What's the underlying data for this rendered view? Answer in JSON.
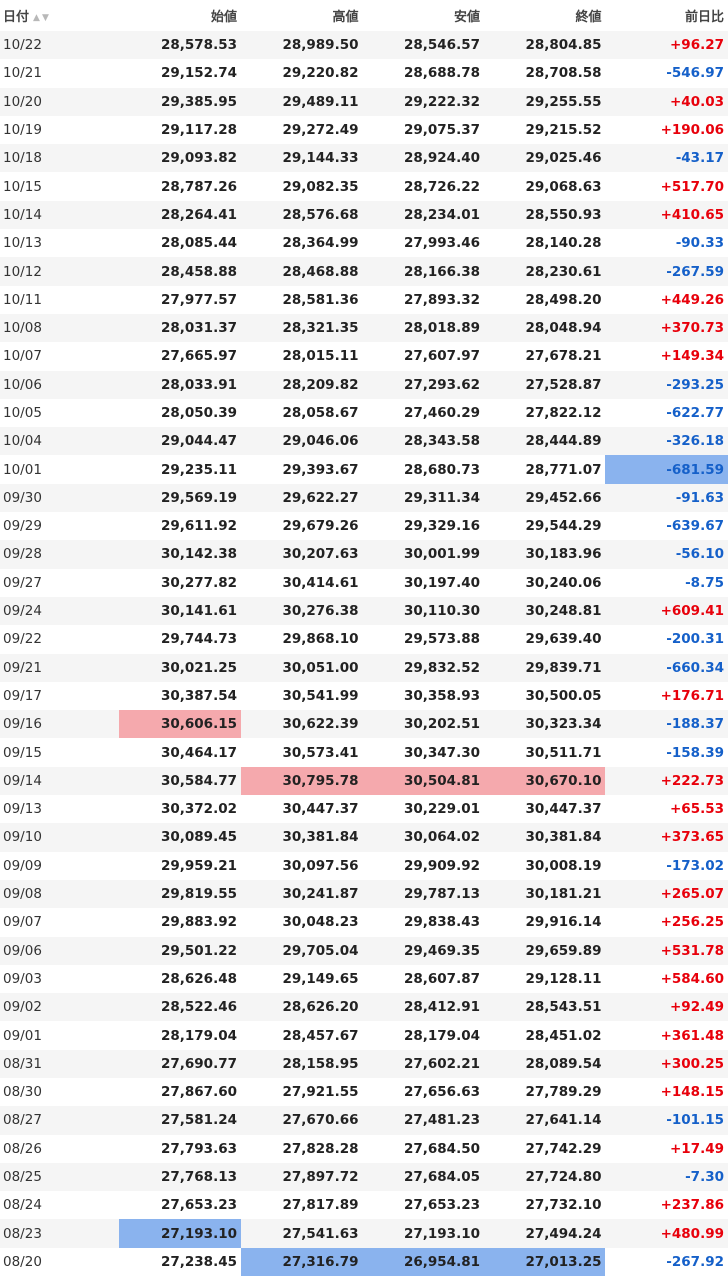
{
  "headers": {
    "date": "日付",
    "open": "始値",
    "high": "高値",
    "low": "安値",
    "close": "終値",
    "change": "前日比"
  },
  "sort_icons": {
    "asc": "▲",
    "desc": "▼"
  },
  "colors": {
    "positive": "#e8000b",
    "negative": "#1560c9",
    "highlight_high": "#f5a9ad",
    "highlight_low": "#8ab3ee"
  },
  "rows": [
    {
      "date": "10/22",
      "open": "28,578.53",
      "high": "28,989.50",
      "low": "28,546.57",
      "close": "28,804.85",
      "change": "+96.27"
    },
    {
      "date": "10/21",
      "open": "29,152.74",
      "high": "29,220.82",
      "low": "28,688.78",
      "close": "28,708.58",
      "change": "-546.97"
    },
    {
      "date": "10/20",
      "open": "29,385.95",
      "high": "29,489.11",
      "low": "29,222.32",
      "close": "29,255.55",
      "change": "+40.03"
    },
    {
      "date": "10/19",
      "open": "29,117.28",
      "high": "29,272.49",
      "low": "29,075.37",
      "close": "29,215.52",
      "change": "+190.06"
    },
    {
      "date": "10/18",
      "open": "29,093.82",
      "high": "29,144.33",
      "low": "28,924.40",
      "close": "29,025.46",
      "change": "-43.17"
    },
    {
      "date": "10/15",
      "open": "28,787.26",
      "high": "29,082.35",
      "low": "28,726.22",
      "close": "29,068.63",
      "change": "+517.70"
    },
    {
      "date": "10/14",
      "open": "28,264.41",
      "high": "28,576.68",
      "low": "28,234.01",
      "close": "28,550.93",
      "change": "+410.65"
    },
    {
      "date": "10/13",
      "open": "28,085.44",
      "high": "28,364.99",
      "low": "27,993.46",
      "close": "28,140.28",
      "change": "-90.33"
    },
    {
      "date": "10/12",
      "open": "28,458.88",
      "high": "28,468.88",
      "low": "28,166.38",
      "close": "28,230.61",
      "change": "-267.59"
    },
    {
      "date": "10/11",
      "open": "27,977.57",
      "high": "28,581.36",
      "low": "27,893.32",
      "close": "28,498.20",
      "change": "+449.26"
    },
    {
      "date": "10/08",
      "open": "28,031.37",
      "high": "28,321.35",
      "low": "28,018.89",
      "close": "28,048.94",
      "change": "+370.73"
    },
    {
      "date": "10/07",
      "open": "27,665.97",
      "high": "28,015.11",
      "low": "27,607.97",
      "close": "27,678.21",
      "change": "+149.34"
    },
    {
      "date": "10/06",
      "open": "28,033.91",
      "high": "28,209.82",
      "low": "27,293.62",
      "close": "27,528.87",
      "change": "-293.25"
    },
    {
      "date": "10/05",
      "open": "28,050.39",
      "high": "28,058.67",
      "low": "27,460.29",
      "close": "27,822.12",
      "change": "-622.77"
    },
    {
      "date": "10/04",
      "open": "29,044.47",
      "high": "29,046.06",
      "low": "28,343.58",
      "close": "28,444.89",
      "change": "-326.18"
    },
    {
      "date": "10/01",
      "open": "29,235.11",
      "high": "29,393.67",
      "low": "28,680.73",
      "close": "28,771.07",
      "change": "-681.59",
      "hl": {
        "change": "blue"
      }
    },
    {
      "date": "09/30",
      "open": "29,569.19",
      "high": "29,622.27",
      "low": "29,311.34",
      "close": "29,452.66",
      "change": "-91.63"
    },
    {
      "date": "09/29",
      "open": "29,611.92",
      "high": "29,679.26",
      "low": "29,329.16",
      "close": "29,544.29",
      "change": "-639.67"
    },
    {
      "date": "09/28",
      "open": "30,142.38",
      "high": "30,207.63",
      "low": "30,001.99",
      "close": "30,183.96",
      "change": "-56.10"
    },
    {
      "date": "09/27",
      "open": "30,277.82",
      "high": "30,414.61",
      "low": "30,197.40",
      "close": "30,240.06",
      "change": "-8.75"
    },
    {
      "date": "09/24",
      "open": "30,141.61",
      "high": "30,276.38",
      "low": "30,110.30",
      "close": "30,248.81",
      "change": "+609.41"
    },
    {
      "date": "09/22",
      "open": "29,744.73",
      "high": "29,868.10",
      "low": "29,573.88",
      "close": "29,639.40",
      "change": "-200.31"
    },
    {
      "date": "09/21",
      "open": "30,021.25",
      "high": "30,051.00",
      "low": "29,832.52",
      "close": "29,839.71",
      "change": "-660.34"
    },
    {
      "date": "09/17",
      "open": "30,387.54",
      "high": "30,541.99",
      "low": "30,358.93",
      "close": "30,500.05",
      "change": "+176.71"
    },
    {
      "date": "09/16",
      "open": "30,606.15",
      "high": "30,622.39",
      "low": "30,202.51",
      "close": "30,323.34",
      "change": "-188.37",
      "hl": {
        "open": "red"
      }
    },
    {
      "date": "09/15",
      "open": "30,464.17",
      "high": "30,573.41",
      "low": "30,347.30",
      "close": "30,511.71",
      "change": "-158.39"
    },
    {
      "date": "09/14",
      "open": "30,584.77",
      "high": "30,795.78",
      "low": "30,504.81",
      "close": "30,670.10",
      "change": "+222.73",
      "hl": {
        "high": "red",
        "low": "red",
        "close": "red"
      }
    },
    {
      "date": "09/13",
      "open": "30,372.02",
      "high": "30,447.37",
      "low": "30,229.01",
      "close": "30,447.37",
      "change": "+65.53"
    },
    {
      "date": "09/10",
      "open": "30,089.45",
      "high": "30,381.84",
      "low": "30,064.02",
      "close": "30,381.84",
      "change": "+373.65"
    },
    {
      "date": "09/09",
      "open": "29,959.21",
      "high": "30,097.56",
      "low": "29,909.92",
      "close": "30,008.19",
      "change": "-173.02"
    },
    {
      "date": "09/08",
      "open": "29,819.55",
      "high": "30,241.87",
      "low": "29,787.13",
      "close": "30,181.21",
      "change": "+265.07"
    },
    {
      "date": "09/07",
      "open": "29,883.92",
      "high": "30,048.23",
      "low": "29,838.43",
      "close": "29,916.14",
      "change": "+256.25"
    },
    {
      "date": "09/06",
      "open": "29,501.22",
      "high": "29,705.04",
      "low": "29,469.35",
      "close": "29,659.89",
      "change": "+531.78"
    },
    {
      "date": "09/03",
      "open": "28,626.48",
      "high": "29,149.65",
      "low": "28,607.87",
      "close": "29,128.11",
      "change": "+584.60"
    },
    {
      "date": "09/02",
      "open": "28,522.46",
      "high": "28,626.20",
      "low": "28,412.91",
      "close": "28,543.51",
      "change": "+92.49"
    },
    {
      "date": "09/01",
      "open": "28,179.04",
      "high": "28,457.67",
      "low": "28,179.04",
      "close": "28,451.02",
      "change": "+361.48"
    },
    {
      "date": "08/31",
      "open": "27,690.77",
      "high": "28,158.95",
      "low": "27,602.21",
      "close": "28,089.54",
      "change": "+300.25"
    },
    {
      "date": "08/30",
      "open": "27,867.60",
      "high": "27,921.55",
      "low": "27,656.63",
      "close": "27,789.29",
      "change": "+148.15"
    },
    {
      "date": "08/27",
      "open": "27,581.24",
      "high": "27,670.66",
      "low": "27,481.23",
      "close": "27,641.14",
      "change": "-101.15"
    },
    {
      "date": "08/26",
      "open": "27,793.63",
      "high": "27,828.28",
      "low": "27,684.50",
      "close": "27,742.29",
      "change": "+17.49"
    },
    {
      "date": "08/25",
      "open": "27,768.13",
      "high": "27,897.72",
      "low": "27,684.05",
      "close": "27,724.80",
      "change": "-7.30"
    },
    {
      "date": "08/24",
      "open": "27,653.23",
      "high": "27,817.89",
      "low": "27,653.23",
      "close": "27,732.10",
      "change": "+237.86"
    },
    {
      "date": "08/23",
      "open": "27,193.10",
      "high": "27,541.63",
      "low": "27,193.10",
      "close": "27,494.24",
      "change": "+480.99",
      "hl": {
        "open": "blue"
      }
    },
    {
      "date": "08/20",
      "open": "27,238.45",
      "high": "27,316.79",
      "low": "26,954.81",
      "close": "27,013.25",
      "change": "-267.92",
      "hl": {
        "high": "blue",
        "low": "blue",
        "close": "blue"
      }
    }
  ]
}
